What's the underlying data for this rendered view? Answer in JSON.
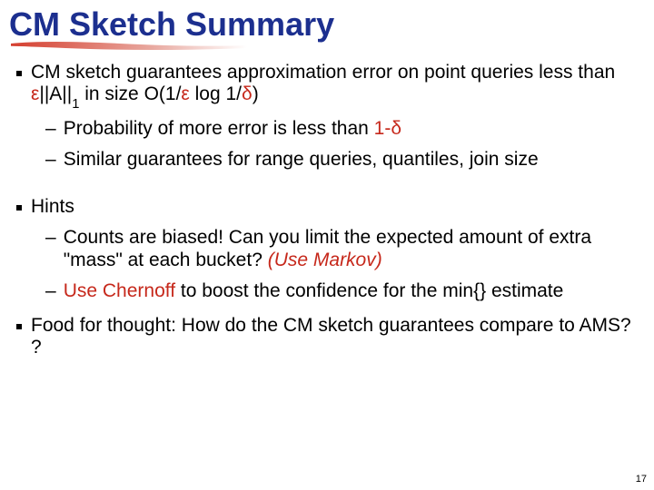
{
  "title": "CM Sketch Summary",
  "bullets": {
    "b1a_pre": "CM sketch guarantees approximation error on point queries less than ",
    "b1a_eps": "ε",
    "b1a_mid1": "||A||",
    "b1a_sub": "1",
    "b1a_mid2": " in size O(1/",
    "b1a_eps2": "ε",
    "b1a_mid3": " log 1/",
    "b1a_delta": "δ",
    "b1a_end": ")",
    "b1a_s1_pre": "Probability of more error is less than ",
    "b1a_s1_red": "1-δ",
    "b1a_s2": "Similar guarantees for range queries, quantiles, join size",
    "b2": "Hints",
    "b2_s1_a": "Counts are biased!   Can you limit the expected amount of extra \"mass\" at each bucket?  ",
    "b2_s1_b": "(Use Markov)",
    "b2_s2_a": "Use Chernoff",
    "b2_s2_b": " to boost the confidence for the min{} estimate",
    "b3": "Food for thought:   How do the CM sketch guarantees compare to AMS? ?"
  },
  "pagenum": "17"
}
